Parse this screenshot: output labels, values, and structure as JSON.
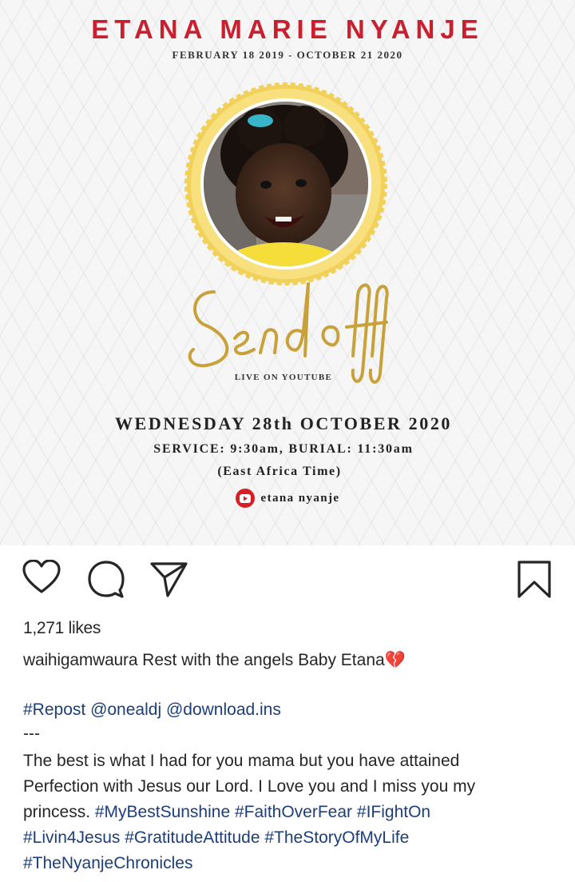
{
  "image": {
    "name": "ETANA MARIE NYANJE",
    "dates": "FEBRUARY 18 2019 - OCTOBER 21 2020",
    "script_title": "Send off",
    "live_label": "LIVE ON YOUTUBE",
    "date_line": "WEDNESDAY 28th OCTOBER 2020",
    "service_line": "SERVICE: 9:30am, BURIAL: 11:30am",
    "timezone_line": "(East Africa Time)",
    "youtube_handle": "etana nyanje",
    "colors": {
      "name": "#c8202e",
      "gold": "#c8a13a",
      "frame": "#f2d15a",
      "youtube": "#d81e25"
    }
  },
  "actions": {
    "like_icon": "heart-icon",
    "comment_icon": "comment-icon",
    "share_icon": "send-icon",
    "save_icon": "bookmark-icon"
  },
  "likes": "1,271 likes",
  "caption": {
    "username": "waihigamwaura",
    "text": "Rest with the angels Baby Etana💔",
    "repost": "#Repost",
    "mention1": "@onealdj",
    "mention2": "@download.ins",
    "separator": "---",
    "body_line1": "The best is what I had for you mama but you have attained",
    "body_line2": "Perfection with Jesus our Lord. I Love you and I miss you my",
    "body_line3": "princess.",
    "tags": [
      "#MyBestSunshine",
      "#FaithOverFear",
      "#IFightOn",
      "#Livin4Jesus",
      "#GratitudeAttitude",
      "#TheStoryOfMyLife",
      "#TheNyanjeChronicles"
    ]
  }
}
